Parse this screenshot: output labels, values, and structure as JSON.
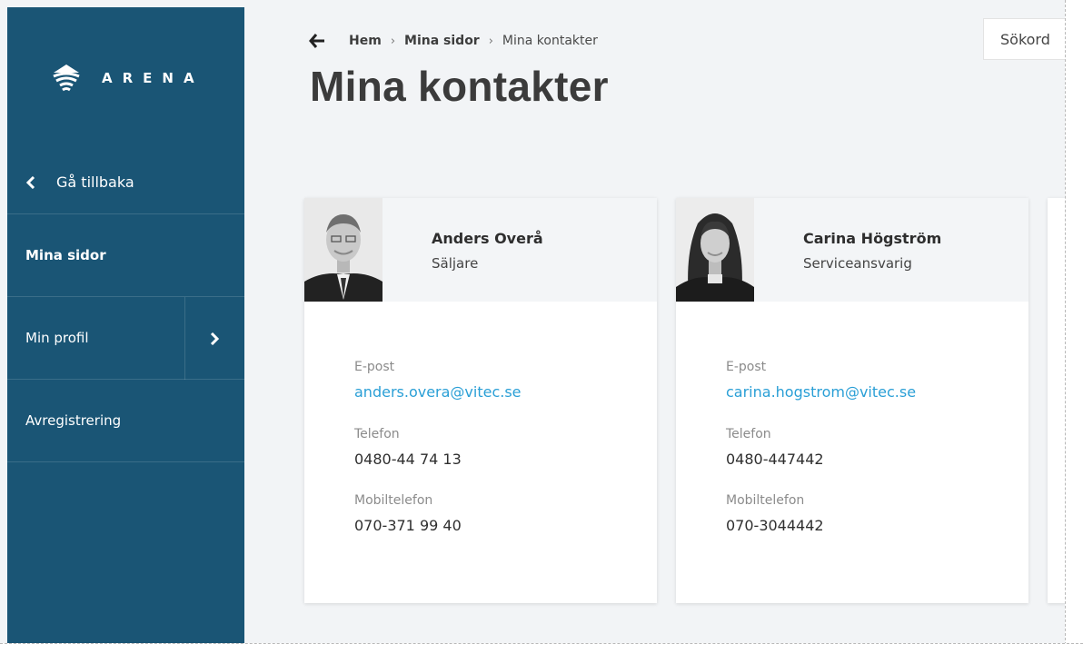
{
  "sidebar": {
    "logo_text": "ARENA",
    "back_label": "Gå tillbaka",
    "items": [
      {
        "label": "Mina sidor",
        "active": true
      },
      {
        "label": "Min profil",
        "expandable": true
      },
      {
        "label": "Avregistrering"
      }
    ]
  },
  "breadcrumb": {
    "items": [
      "Hem",
      "Mina sidor",
      "Mina kontakter"
    ],
    "separator": "›"
  },
  "page_title": "Mina kontakter",
  "search": {
    "placeholder": "Sökord"
  },
  "contacts": [
    {
      "name": "Anders Overå",
      "role": "Säljare",
      "email_label": "E-post",
      "email": "anders.overa@vitec.se",
      "phone_label": "Telefon",
      "phone": "0480-44 74 13",
      "mobile_label": "Mobiltelefon",
      "mobile": "070-371 99 40"
    },
    {
      "name": "Carina Högström",
      "role": "Serviceansvarig",
      "email_label": "E-post",
      "email": "carina.hogstrom@vitec.se",
      "phone_label": "Telefon",
      "phone": "0480-447442",
      "mobile_label": "Mobiltelefon",
      "mobile": "070-3044442"
    }
  ],
  "colors": {
    "sidebar_bg": "#1a5575",
    "link": "#2a9fd6",
    "page_bg": "#f2f4f6"
  }
}
